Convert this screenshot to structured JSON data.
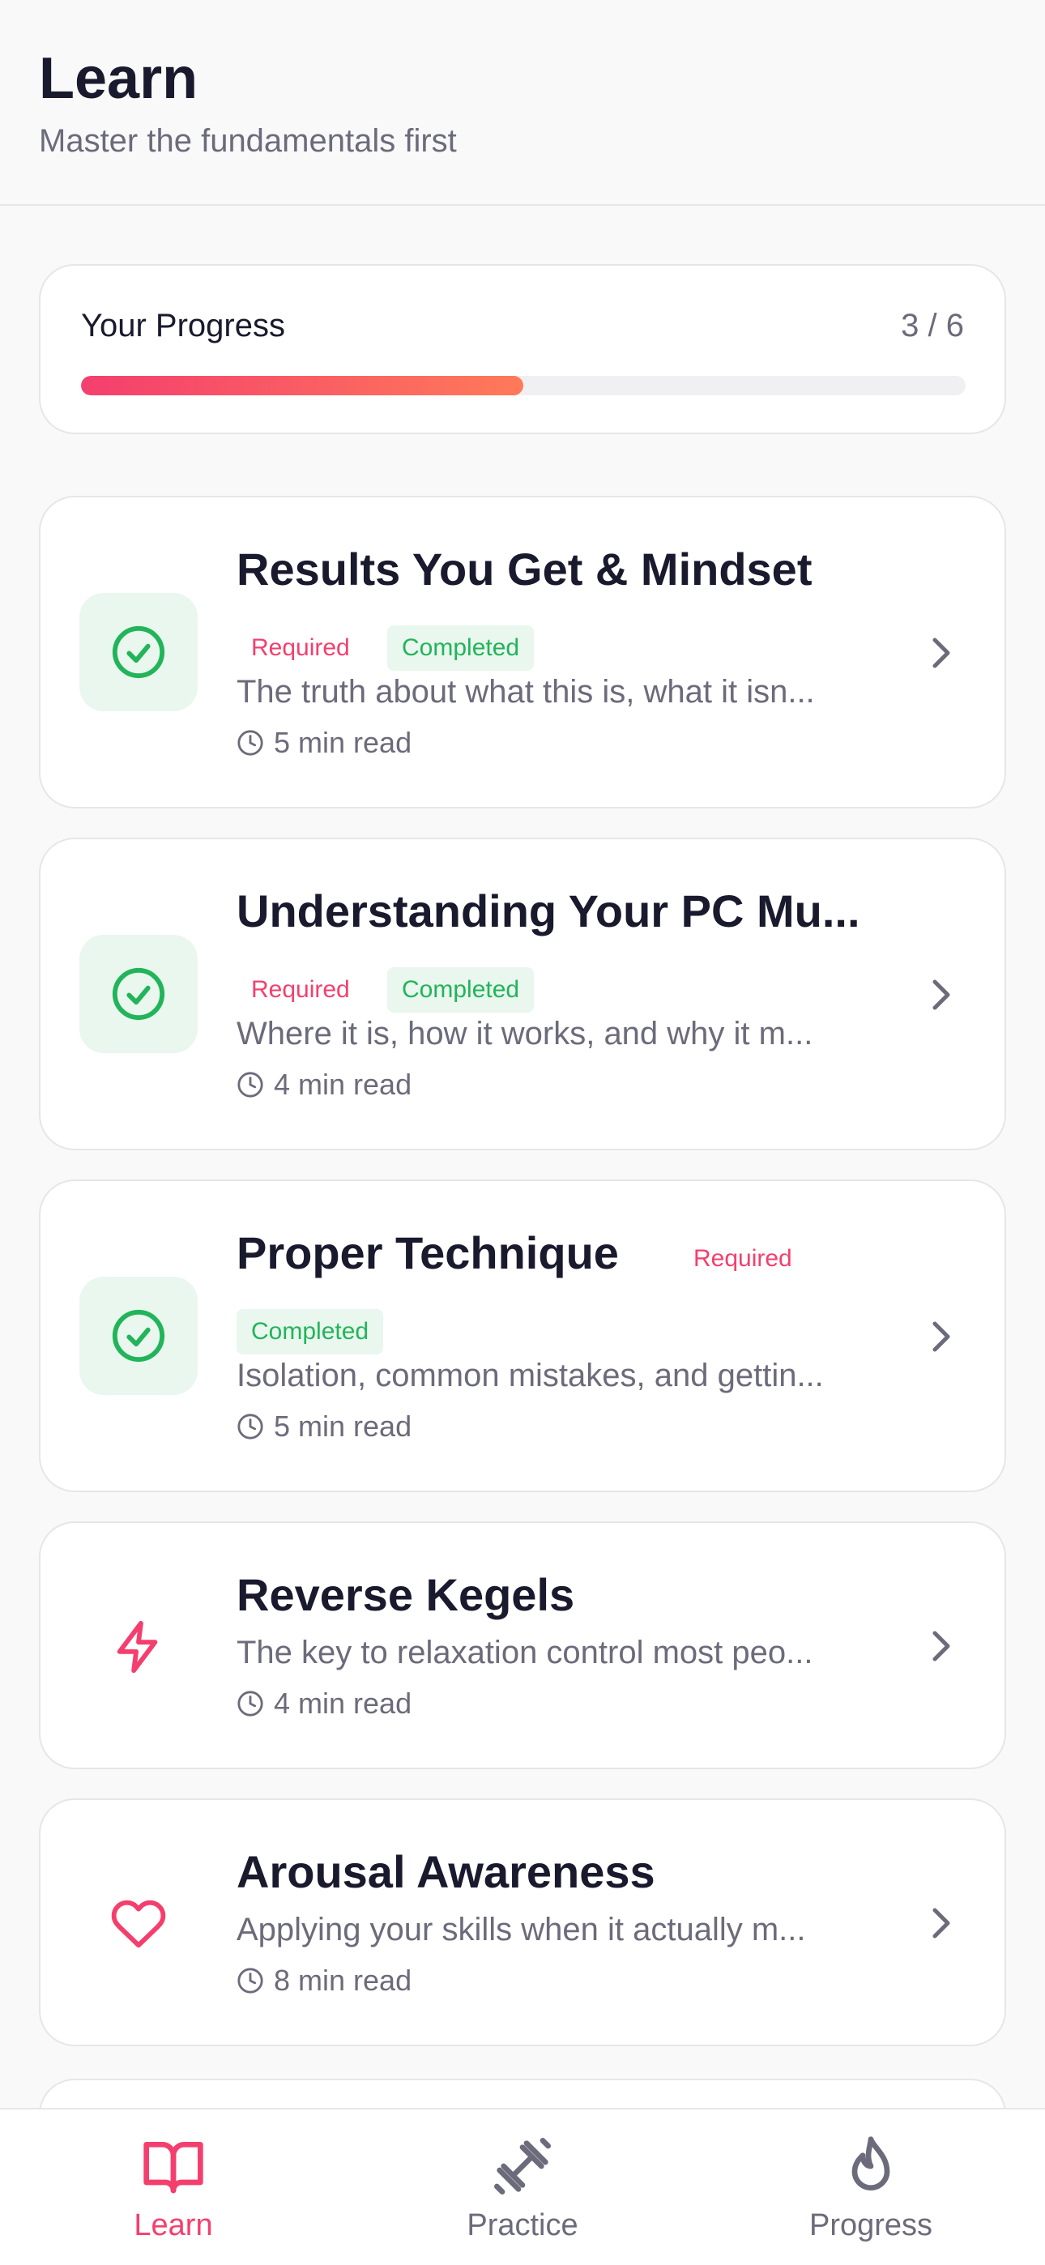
{
  "header": {
    "title": "Learn",
    "subtitle": "Master the fundamentals first"
  },
  "progress": {
    "label": "Your Progress",
    "count": "3 / 6",
    "fraction": 0.5
  },
  "lessons": [
    {
      "title": "Results You Get & Mindset",
      "required": "Required",
      "completed": "Completed",
      "description": "The truth about what this is, what it isn...",
      "read_time": "5 min read"
    },
    {
      "title": "Understanding Your PC Mu...",
      "required": "Required",
      "completed": "Completed",
      "description": "Where it is, how it works, and why it m...",
      "read_time": "4 min read"
    },
    {
      "title": "Proper Technique",
      "required": "Required",
      "completed": "Completed",
      "description": "Isolation, common mistakes, and gettin...",
      "read_time": "5 min read"
    },
    {
      "title": "Reverse Kegels",
      "description": "The key to relaxation control most peo...",
      "read_time": "4 min read",
      "icon": "lightning-icon"
    },
    {
      "title": "Arousal Awareness",
      "description": "Applying your skills when it actually m...",
      "read_time": "8 min read",
      "icon": "heart-icon"
    }
  ],
  "tabs": [
    {
      "label": "Learn",
      "icon": "book-icon",
      "active": true
    },
    {
      "label": "Practice",
      "icon": "dumbbell-icon",
      "active": false
    },
    {
      "label": "Progress",
      "icon": "flame-icon",
      "active": false
    }
  ],
  "colors": {
    "accent": "#f43f6e",
    "success": "#22b45a",
    "text": "#1a1a2e",
    "muted": "#6b6b7b"
  }
}
